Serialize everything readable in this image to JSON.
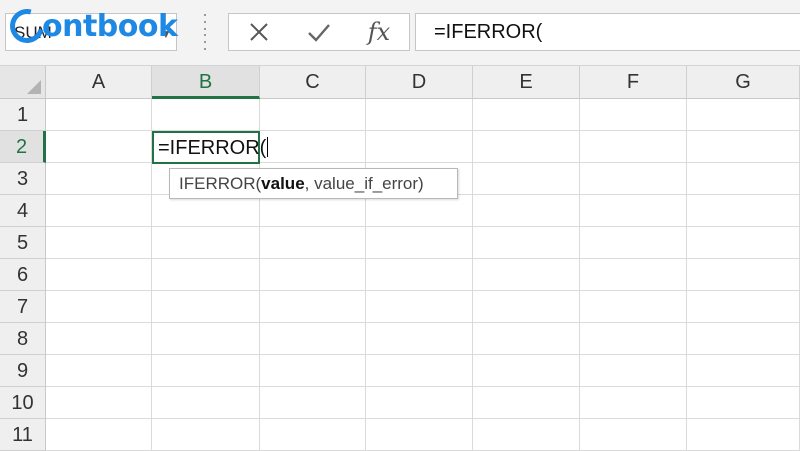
{
  "name_box": {
    "value": "SUM",
    "dropdown_icon": "chevron-down-icon"
  },
  "logo": {
    "text": "ontbook"
  },
  "formula_toolbar": {
    "cancel_icon": "close-icon",
    "enter_icon": "check-icon",
    "insert_function_label": "fx"
  },
  "formula_bar": {
    "value": "=IFERROR("
  },
  "columns": [
    "A",
    "B",
    "C",
    "D",
    "E",
    "F",
    "G"
  ],
  "rows": [
    "1",
    "2",
    "3",
    "4",
    "5",
    "6",
    "7",
    "8",
    "9",
    "10",
    "11"
  ],
  "active_cell": {
    "ref": "B2",
    "value": "=IFERROR("
  },
  "tooltip": {
    "function_name": "IFERROR(",
    "arg_current": "value",
    "rest": ", value_if_error)"
  },
  "colors": {
    "accent_green": "#217346",
    "logo_blue": "#1e88e5"
  }
}
